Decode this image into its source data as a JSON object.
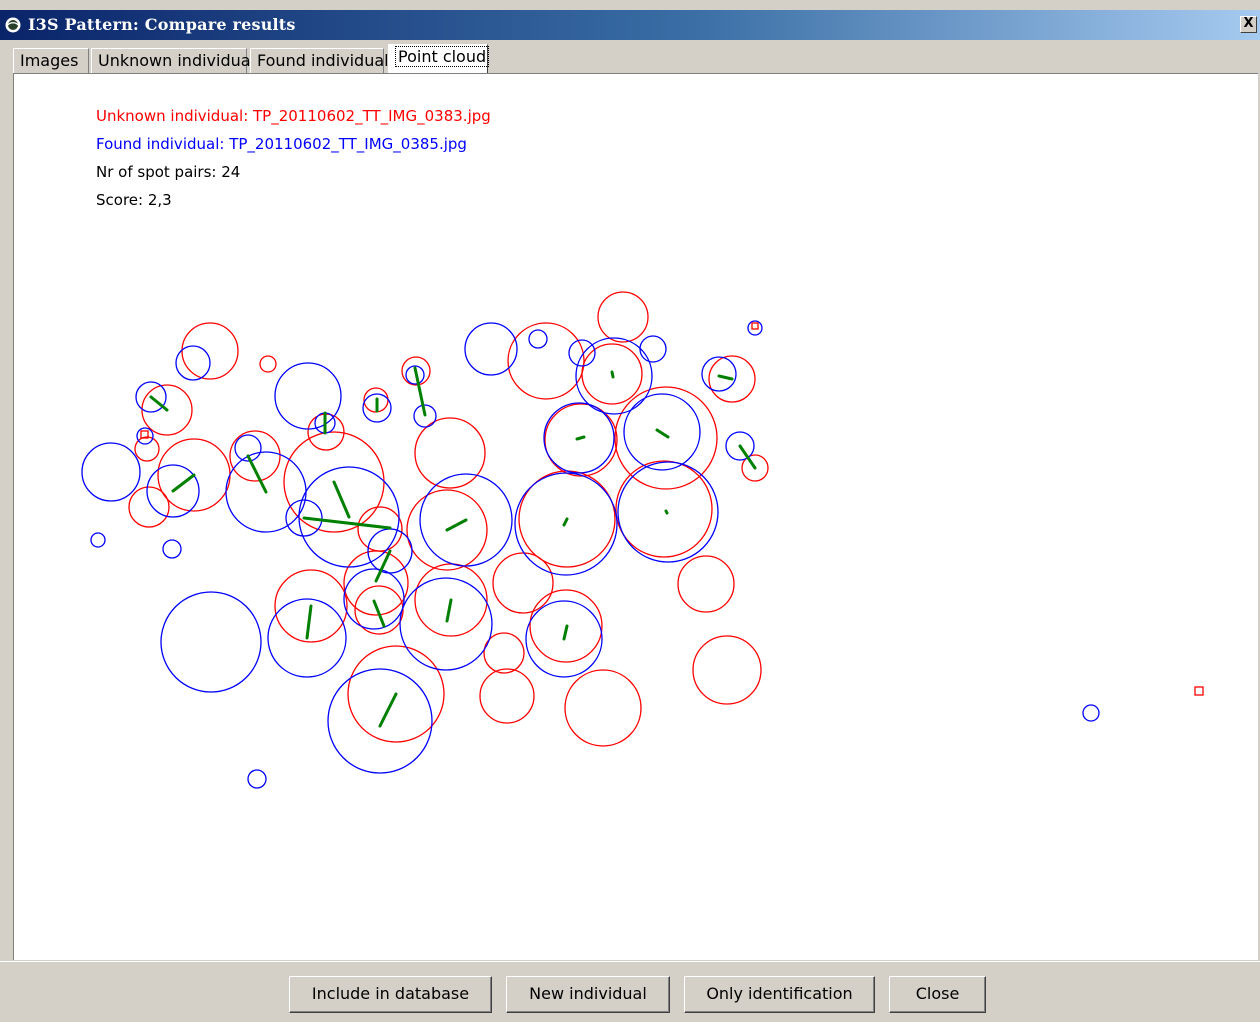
{
  "window": {
    "title": "I3S Pattern: Compare results",
    "close_label": "X"
  },
  "tabs": [
    {
      "label": "Images"
    },
    {
      "label": "Unknown individual"
    },
    {
      "label": "Found individual"
    },
    {
      "label": "Point cloud",
      "selected": true
    }
  ],
  "info": {
    "unknown": "Unknown individual: TP_20110602_TT_IMG_0383.jpg",
    "found": "Found individual: TP_20110602_TT_IMG_0385.jpg",
    "pairs": "Nr of spot pairs: 24",
    "score": "Score: 2,3"
  },
  "colors": {
    "unknown": "#ff0000",
    "found": "#0000ff",
    "pair_line": "#008000"
  },
  "buttons": {
    "include": "Include in database",
    "new_individual": "New individual",
    "only_identification": "Only identification",
    "close": "Close"
  }
}
